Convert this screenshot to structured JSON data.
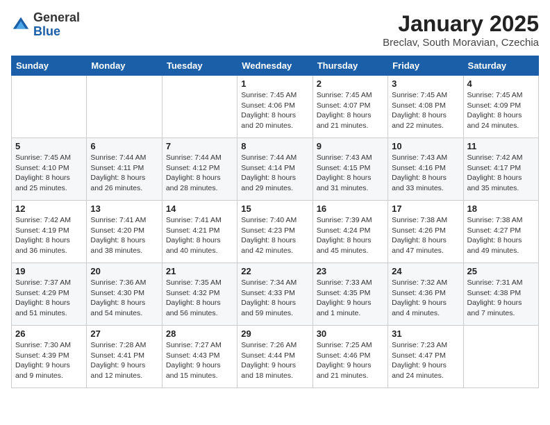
{
  "logo": {
    "general": "General",
    "blue": "Blue"
  },
  "title": "January 2025",
  "location": "Breclav, South Moravian, Czechia",
  "days_of_week": [
    "Sunday",
    "Monday",
    "Tuesday",
    "Wednesday",
    "Thursday",
    "Friday",
    "Saturday"
  ],
  "weeks": [
    [
      {
        "day": "",
        "info": ""
      },
      {
        "day": "",
        "info": ""
      },
      {
        "day": "",
        "info": ""
      },
      {
        "day": "1",
        "info": "Sunrise: 7:45 AM\nSunset: 4:06 PM\nDaylight: 8 hours and 20 minutes."
      },
      {
        "day": "2",
        "info": "Sunrise: 7:45 AM\nSunset: 4:07 PM\nDaylight: 8 hours and 21 minutes."
      },
      {
        "day": "3",
        "info": "Sunrise: 7:45 AM\nSunset: 4:08 PM\nDaylight: 8 hours and 22 minutes."
      },
      {
        "day": "4",
        "info": "Sunrise: 7:45 AM\nSunset: 4:09 PM\nDaylight: 8 hours and 24 minutes."
      }
    ],
    [
      {
        "day": "5",
        "info": "Sunrise: 7:45 AM\nSunset: 4:10 PM\nDaylight: 8 hours and 25 minutes."
      },
      {
        "day": "6",
        "info": "Sunrise: 7:44 AM\nSunset: 4:11 PM\nDaylight: 8 hours and 26 minutes."
      },
      {
        "day": "7",
        "info": "Sunrise: 7:44 AM\nSunset: 4:12 PM\nDaylight: 8 hours and 28 minutes."
      },
      {
        "day": "8",
        "info": "Sunrise: 7:44 AM\nSunset: 4:14 PM\nDaylight: 8 hours and 29 minutes."
      },
      {
        "day": "9",
        "info": "Sunrise: 7:43 AM\nSunset: 4:15 PM\nDaylight: 8 hours and 31 minutes."
      },
      {
        "day": "10",
        "info": "Sunrise: 7:43 AM\nSunset: 4:16 PM\nDaylight: 8 hours and 33 minutes."
      },
      {
        "day": "11",
        "info": "Sunrise: 7:42 AM\nSunset: 4:17 PM\nDaylight: 8 hours and 35 minutes."
      }
    ],
    [
      {
        "day": "12",
        "info": "Sunrise: 7:42 AM\nSunset: 4:19 PM\nDaylight: 8 hours and 36 minutes."
      },
      {
        "day": "13",
        "info": "Sunrise: 7:41 AM\nSunset: 4:20 PM\nDaylight: 8 hours and 38 minutes."
      },
      {
        "day": "14",
        "info": "Sunrise: 7:41 AM\nSunset: 4:21 PM\nDaylight: 8 hours and 40 minutes."
      },
      {
        "day": "15",
        "info": "Sunrise: 7:40 AM\nSunset: 4:23 PM\nDaylight: 8 hours and 42 minutes."
      },
      {
        "day": "16",
        "info": "Sunrise: 7:39 AM\nSunset: 4:24 PM\nDaylight: 8 hours and 45 minutes."
      },
      {
        "day": "17",
        "info": "Sunrise: 7:38 AM\nSunset: 4:26 PM\nDaylight: 8 hours and 47 minutes."
      },
      {
        "day": "18",
        "info": "Sunrise: 7:38 AM\nSunset: 4:27 PM\nDaylight: 8 hours and 49 minutes."
      }
    ],
    [
      {
        "day": "19",
        "info": "Sunrise: 7:37 AM\nSunset: 4:29 PM\nDaylight: 8 hours and 51 minutes."
      },
      {
        "day": "20",
        "info": "Sunrise: 7:36 AM\nSunset: 4:30 PM\nDaylight: 8 hours and 54 minutes."
      },
      {
        "day": "21",
        "info": "Sunrise: 7:35 AM\nSunset: 4:32 PM\nDaylight: 8 hours and 56 minutes."
      },
      {
        "day": "22",
        "info": "Sunrise: 7:34 AM\nSunset: 4:33 PM\nDaylight: 8 hours and 59 minutes."
      },
      {
        "day": "23",
        "info": "Sunrise: 7:33 AM\nSunset: 4:35 PM\nDaylight: 9 hours and 1 minute."
      },
      {
        "day": "24",
        "info": "Sunrise: 7:32 AM\nSunset: 4:36 PM\nDaylight: 9 hours and 4 minutes."
      },
      {
        "day": "25",
        "info": "Sunrise: 7:31 AM\nSunset: 4:38 PM\nDaylight: 9 hours and 7 minutes."
      }
    ],
    [
      {
        "day": "26",
        "info": "Sunrise: 7:30 AM\nSunset: 4:39 PM\nDaylight: 9 hours and 9 minutes."
      },
      {
        "day": "27",
        "info": "Sunrise: 7:28 AM\nSunset: 4:41 PM\nDaylight: 9 hours and 12 minutes."
      },
      {
        "day": "28",
        "info": "Sunrise: 7:27 AM\nSunset: 4:43 PM\nDaylight: 9 hours and 15 minutes."
      },
      {
        "day": "29",
        "info": "Sunrise: 7:26 AM\nSunset: 4:44 PM\nDaylight: 9 hours and 18 minutes."
      },
      {
        "day": "30",
        "info": "Sunrise: 7:25 AM\nSunset: 4:46 PM\nDaylight: 9 hours and 21 minutes."
      },
      {
        "day": "31",
        "info": "Sunrise: 7:23 AM\nSunset: 4:47 PM\nDaylight: 9 hours and 24 minutes."
      },
      {
        "day": "",
        "info": ""
      }
    ]
  ]
}
